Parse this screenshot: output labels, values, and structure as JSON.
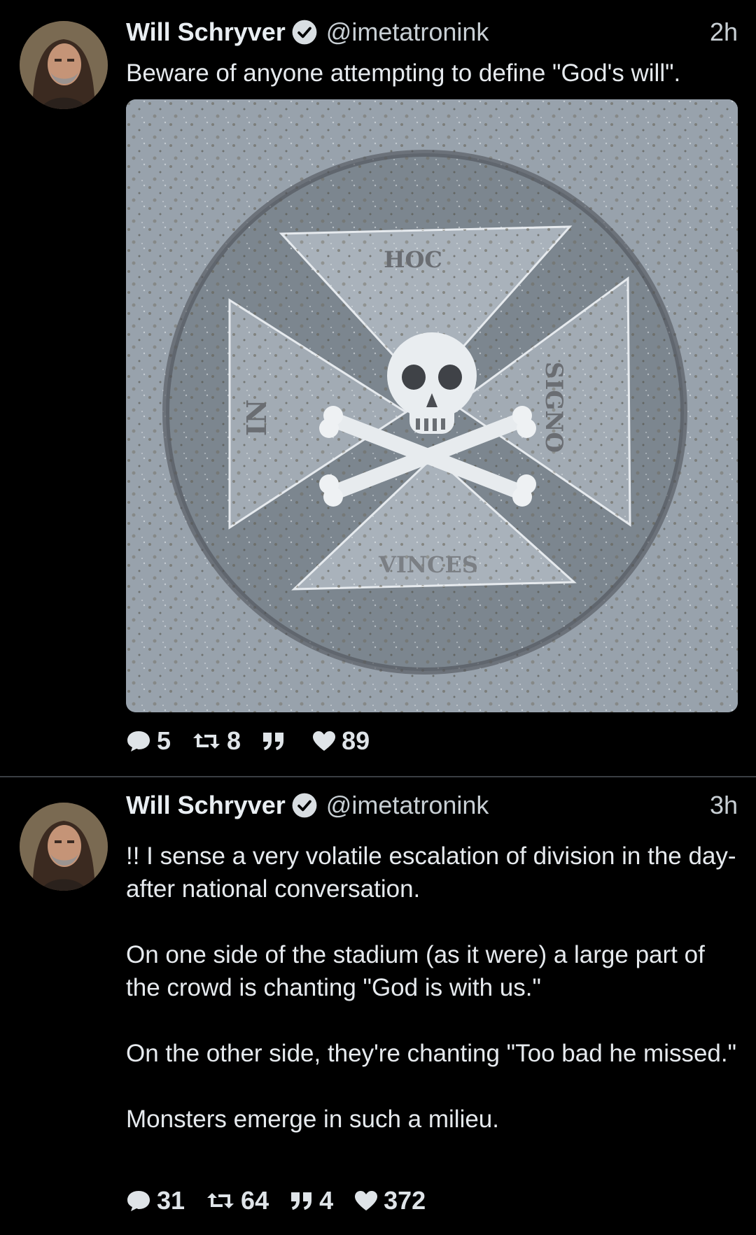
{
  "tweets": [
    {
      "author": "Will Schryver",
      "handle": "@imetatronink",
      "time": "2h",
      "text": "Beware of anyone attempting to define \"God's will\".",
      "media": {
        "description_icons": "tombstone-carving-image",
        "carved_words": [
          "HOC",
          "IN",
          "SIGNO",
          "VINCES"
        ]
      },
      "stats": {
        "replies": "5",
        "retweets": "8",
        "quotes": "",
        "likes": "89"
      }
    },
    {
      "author": "Will Schryver",
      "handle": "@imetatronink",
      "time": "3h",
      "text": "!! I sense a very volatile escalation of division in the day-after national conversation.\n\nOn one side of the stadium (as it were) a large part of the crowd is chanting \"God is with us.\"\n\nOn the other side, they're chanting \"Too bad he missed.\"\n\nMonsters emerge in such a milieu.",
      "stats": {
        "replies": "31",
        "retweets": "64",
        "quotes": "4",
        "likes": "372"
      }
    }
  ],
  "colors": {
    "background": "#000000",
    "verified": "#d9dee2",
    "text": "#e6eaee",
    "divider": "#3a3f44"
  }
}
